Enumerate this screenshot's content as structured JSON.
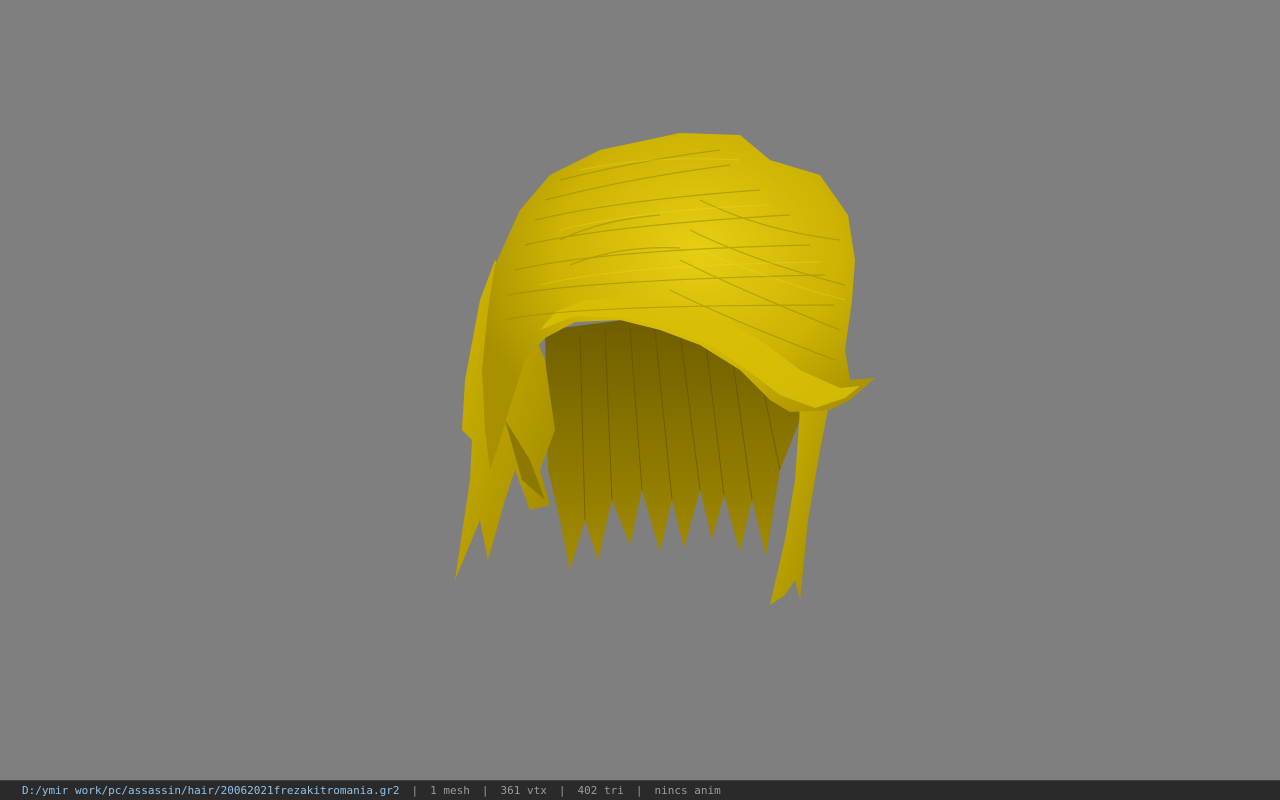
{
  "viewer": {
    "background": "#7f7f7f",
    "model": {
      "name": "hair-mesh",
      "color_light": "#e4cc10",
      "color_mid": "#c9b000",
      "color_dark": "#7f6c00"
    }
  },
  "statusbar": {
    "file_path": "D:/ymir work/pc/assassin/hair/20062021frezakitromania.gr2",
    "separator": "|",
    "mesh_count": "1 mesh",
    "vertex_count": "361 vtx",
    "triangle_count": "402 tri",
    "anim_status": "nincs anim",
    "path_color": "#8fc0e8",
    "text_color": "#9a9a9a"
  }
}
